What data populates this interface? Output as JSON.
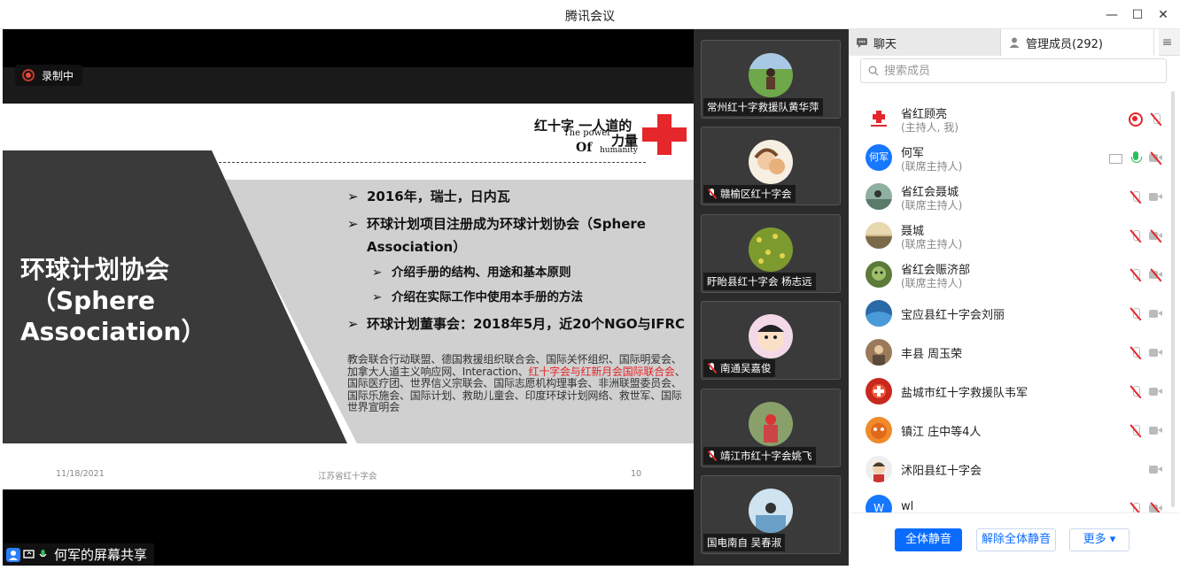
{
  "window": {
    "title": "腾讯会议"
  },
  "recording": {
    "label": "录制中"
  },
  "slide": {
    "header_title": "红十字 一人道的",
    "header_en1": "The power",
    "header_cn2": "力量",
    "header_en2": "Of",
    "header_en3": "humanity",
    "big_title_line1": "环球计划协会",
    "big_title_line2": "（Sphere",
    "big_title_line3": "Association）",
    "bullet1": "2016年，瑞士，日内瓦",
    "bullet2a": "环球计划项目注册成为环球计划协会（Sphere",
    "bullet2b": "Association）",
    "sub1": "介绍手册的结构、用途和基本原则",
    "sub2": "介绍在实际工作中使用本手册的方法",
    "bullet3": "环球计划董事会：2018年5月，近20个NGO与IFRC",
    "para_a": "教会联合行动联盟、德国救援组织联合会、国际关怀组织、国际明爱会、加拿大人道主义响应网、Interaction、",
    "para_red": "红十字会与红新月会国际联合会",
    "para_b": "、国际医疗团、世界信义宗联会、国际志愿机构理事会、非洲联盟委员会、国际乐施会、国际计划、救助儿童会、印度环球计划网络、救世军、国际世界宣明会",
    "footer_date": "11/18/2021",
    "footer_org": "江苏省红十字会",
    "footer_page": "10",
    "marker": "➢"
  },
  "share": {
    "label": "何军的屏幕共享"
  },
  "videos": [
    {
      "name": "常州红十字救援队黄华萍",
      "muted": false
    },
    {
      "name": "赣榆区红十字会",
      "muted": true
    },
    {
      "name": "盱眙县红十字会 杨志远",
      "muted": false
    },
    {
      "name": "南通吴嘉俊",
      "muted": true
    },
    {
      "name": "靖江市红十字会姚飞",
      "muted": true
    },
    {
      "name": "国电南自 吴春淑",
      "muted": false
    }
  ],
  "panel": {
    "tab_chat": "聊天",
    "tab_members": "管理成员(292)",
    "search_placeholder": "搜索成员",
    "menu_glyph": "≡",
    "members": [
      {
        "name": "省红顾亮",
        "role": "(主持人, 我)"
      },
      {
        "name": "何军",
        "role": "(联席主持人)",
        "avatar_text": "何军"
      },
      {
        "name": "省红会聂城",
        "role": "(联席主持人)"
      },
      {
        "name": "聂城",
        "role": "(联席主持人)"
      },
      {
        "name": "省红会赈济部",
        "role": "(联席主持人)"
      },
      {
        "name": "宝应县红十字会刘丽",
        "role": ""
      },
      {
        "name": "丰县 周玉荣",
        "role": ""
      },
      {
        "name": "盐城市红十字救援队韦军",
        "role": ""
      },
      {
        "name": "镇江 庄中等4人",
        "role": ""
      },
      {
        "name": "沭阳县红十字会",
        "role": ""
      },
      {
        "name": "wl",
        "role": "",
        "avatar_text": "W"
      }
    ],
    "btn_mute_all": "全体静音",
    "btn_unmute_all": "解除全体静音",
    "btn_more": "更多 ▾"
  },
  "colors": {
    "accent": "#0a6cff",
    "red_cross": "#e5262b",
    "dark": "#333333"
  }
}
